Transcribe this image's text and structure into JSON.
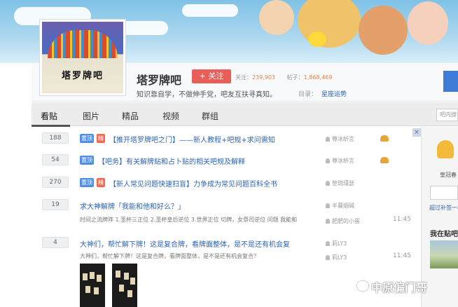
{
  "forum": {
    "avatar_text": "塔罗牌吧",
    "name": "塔罗牌吧",
    "follow_label": "+ 关注",
    "followers_label": "关注：",
    "followers_count": "239,903",
    "posts_label": "帖子：",
    "posts_count": "1,868,469",
    "slogan": "知识靠自学，不做伸手党，吧友互扶寻真知。",
    "directory_label": "目录：",
    "directory_link": "星座运势"
  },
  "tabs": [
    "看贴",
    "图片",
    "精品",
    "视频",
    "群组"
  ],
  "search_placeholder": "吧内搜",
  "tag_labels": {
    "top": "置顶",
    "selected": "精"
  },
  "threads": [
    {
      "replies": "188",
      "title": "【推开塔罗牌吧之门】——新人教程+吧规+求问需知",
      "author": "尊冰昕言"
    },
    {
      "replies": "54",
      "title": "【吧务】有关解牌贴和占卜贴的相关吧规及解释",
      "author": "尊冰昕言"
    },
    {
      "replies": "270",
      "title": "【新人常见问题快速扫盲】力争成为常见问题百科全书",
      "author": "笹琉瑾瑟"
    },
    {
      "replies": "19",
      "title": "求大神解牌「我能和他和好么？」",
      "author": "半暮烟碱",
      "summary": "时间之流牌阵 1.圣杯三正位 2.圣杯皇后逆位 3.世界正位 切牌，女祭司逆位 问题 我能和",
      "last_replier": "肥肥的小蛋",
      "time": "11:45"
    },
    {
      "replies": "4",
      "title": "大神们，帮忙解下牌！这是复合牌，看牌面整体，是不是还有机会复",
      "author": "莉LY3",
      "summary": "大神们，帮忙解下牌！这是复合牌，看牌面整体，是不是还有机会复合？",
      "last_replier": "莉LY3",
      "time": "11:45"
    }
  ],
  "sidebar": {
    "crown_label": "皇冠春",
    "link": "超过补签一楼",
    "heading": "我在贴吧"
  },
  "watermark": "中原偏门哥",
  "colors": {
    "link": "#2d64b3",
    "follow": "#e85e58",
    "tag_top": "#4f8fe3",
    "tag_selected": "#f36a52"
  }
}
